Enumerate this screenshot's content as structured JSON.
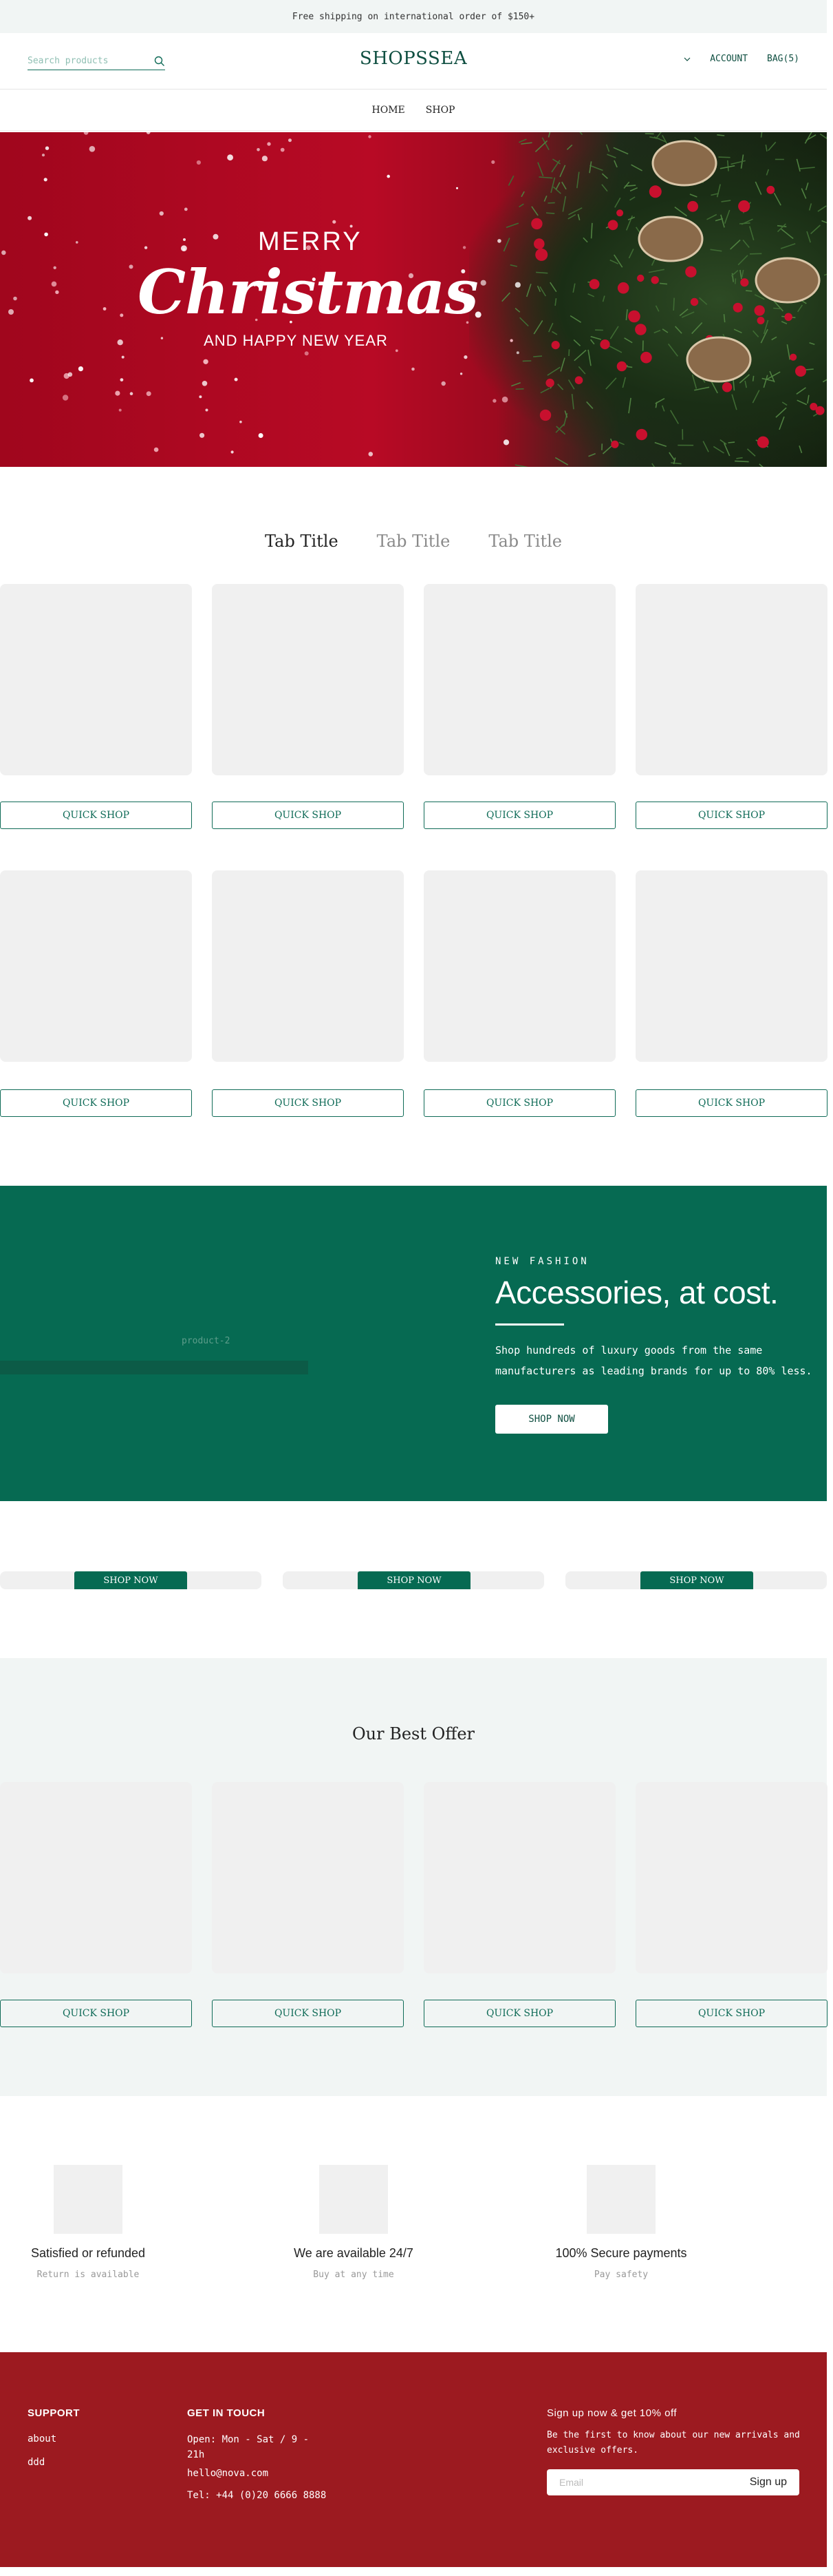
{
  "announcement": "Free shipping on international order of $150+",
  "header": {
    "search_placeholder": "Search products",
    "logo": "SHOPSSEA",
    "account": "ACCOUNT",
    "bag": "BAG(5)"
  },
  "nav": [
    "HOME",
    "SHOP"
  ],
  "hero": {
    "merry": "MERRY",
    "christmas": "Christmas",
    "new_year": "AND HAPPY NEW YEAR"
  },
  "tabs": [
    {
      "label": "Tab Title",
      "active": true
    },
    {
      "label": "Tab Title",
      "active": false
    },
    {
      "label": "Tab Title",
      "active": false
    }
  ],
  "quick_shop_label": "QUICK SHOP",
  "promo": {
    "image_alt": "product-2",
    "kicker": "NEW FASHION",
    "title": "Accessories, at cost.",
    "description": "Shop hundreds of luxury goods from the same manufacturers as leading brands for up to 80% less.",
    "button": "SHOP NOW"
  },
  "collections": {
    "button": "SHOP NOW"
  },
  "offer": {
    "title": "Our Best Offer"
  },
  "features": [
    {
      "title": "Satisfied or refunded",
      "subtitle": "Return is available"
    },
    {
      "title": "We are available 24/7",
      "subtitle": "Buy at any time"
    },
    {
      "title": "100% Secure payments",
      "subtitle": "Pay safety"
    }
  ],
  "footer": {
    "support_title": "SUPPORT",
    "support_links": [
      "about",
      "ddd"
    ],
    "contact_title": "GET IN TOUCH",
    "hours": "Open: Mon - Sat / 9 - 21h",
    "email": "hello@nova.com",
    "phone": "Tel: +44 (0)20 6666 8888",
    "newsletter_title": "Sign up now & get 10% off",
    "newsletter_text": "Be the first to know about our new arrivals and exclusive offers.",
    "email_placeholder": "Email",
    "signup_button": "Sign up"
  },
  "colors": {
    "brand_green": "#066a52",
    "footer_red": "#9c1a20",
    "light_bg": "#f1f5f4"
  }
}
